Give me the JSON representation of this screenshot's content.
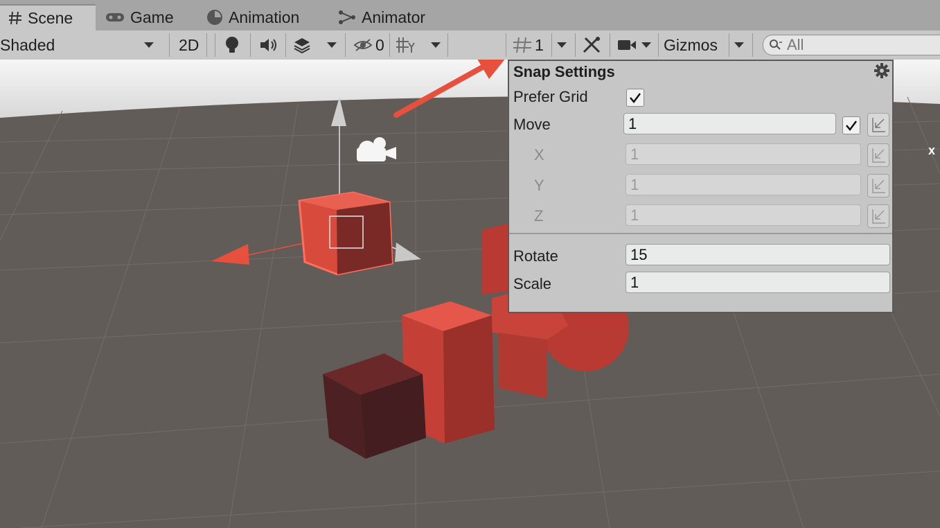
{
  "tabs": [
    {
      "label": "Scene",
      "icon": "hash-icon",
      "active": true
    },
    {
      "label": "Game",
      "icon": "gamepad-icon",
      "active": false
    },
    {
      "label": "Animation",
      "icon": "clock-icon",
      "active": false
    },
    {
      "label": "Animator",
      "icon": "animator-icon",
      "active": false
    }
  ],
  "toolbar": {
    "draw_mode": "Shaded",
    "mode_2d": "2D",
    "hidden_count": "0",
    "grid_size": "1",
    "gizmos_label": "Gizmos",
    "search_placeholder": "All"
  },
  "snap_settings": {
    "title": "Snap Settings",
    "prefer_grid_label": "Prefer Grid",
    "prefer_grid_checked": true,
    "move_label": "Move",
    "move_value": "1",
    "move_linked": true,
    "x_label": "X",
    "x_value": "1",
    "y_label": "Y",
    "y_value": "1",
    "z_label": "Z",
    "z_value": "1",
    "rotate_label": "Rotate",
    "rotate_value": "15",
    "scale_label": "Scale",
    "scale_value": "1"
  },
  "scene": {
    "axis_label": "x",
    "accent": "#e8503e"
  }
}
